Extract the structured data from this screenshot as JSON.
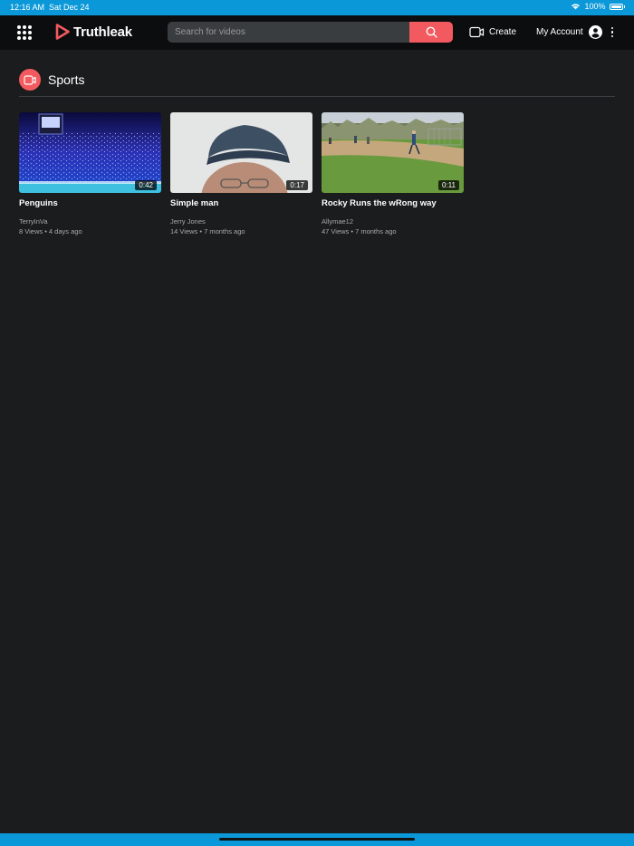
{
  "status_bar": {
    "time": "12:16 AM",
    "date": "Sat Dec 24",
    "battery": "100%"
  },
  "nav": {
    "brand": "Truthleak",
    "search_placeholder": "Search for videos",
    "create_label": "Create",
    "account_label": "My Account"
  },
  "section": {
    "title": "Sports"
  },
  "videos": [
    {
      "title": "Penguins",
      "duration": "0:42",
      "author": "TerryInVa",
      "meta": "8 Views • 4 days ago"
    },
    {
      "title": "Simple man",
      "duration": "0:17",
      "author": "Jerry Jones",
      "meta": "14 Views • 7 months ago"
    },
    {
      "title": "Rocky Runs the wRong way",
      "duration": "0:11",
      "author": "Allymae12",
      "meta": "47 Views • 7 months ago"
    }
  ],
  "colors": {
    "accent": "#f25a5f",
    "status_bar": "#0a98d8",
    "background": "#1a1c1d",
    "navbar": "#0c0d0e"
  }
}
